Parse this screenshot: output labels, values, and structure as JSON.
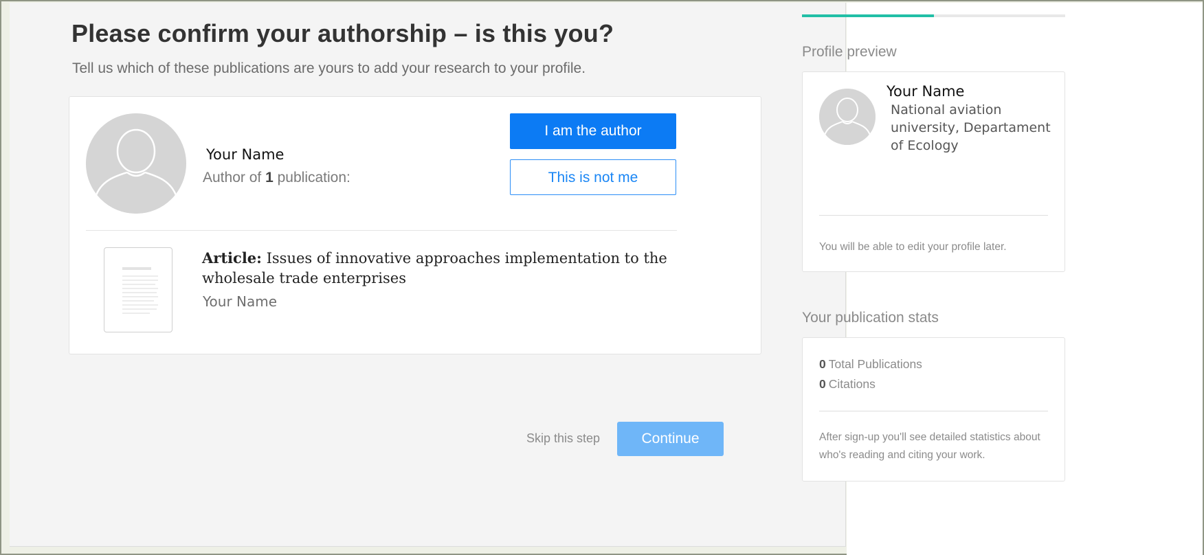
{
  "header": {
    "title": "Please confirm your authorship – is this you?",
    "subtitle": "Tell us which of these publications are yours to add your research to your profile."
  },
  "author_card": {
    "name": "Your Name",
    "meta_prefix": "Author of",
    "publication_count": "1",
    "meta_suffix": "publication:",
    "confirm_button": "I am the author",
    "reject_button": "This is not me",
    "publication": {
      "type_label": "Article:",
      "title": "Issues of innovative approaches implementation to the wholesale trade enterprises",
      "author": "Your Name"
    }
  },
  "footer": {
    "skip_label": "Skip this step",
    "continue_label": "Continue"
  },
  "sidebar": {
    "progress_fraction": 0.5,
    "profile_preview": {
      "section_title": "Profile preview",
      "name": "Your Name",
      "affiliation": "National aviation university, Departament of Ecology",
      "note": "You will be able to edit your profile later."
    },
    "stats": {
      "section_title": "Your publication stats",
      "total_publications_value": "0",
      "total_publications_label": "Total Publications",
      "citations_value": "0",
      "citations_label": "Citations",
      "note": "After sign-up you'll see detailed statistics about who's reading and citing your work."
    }
  },
  "colors": {
    "primary_button": "#0c7bf4",
    "continue_button": "#6fb6f8",
    "progress": "#22bfa6",
    "avatar": "#d5d5d5"
  },
  "icons": {
    "avatar": "user-silhouette-icon",
    "document": "document-thumbnail-icon"
  }
}
